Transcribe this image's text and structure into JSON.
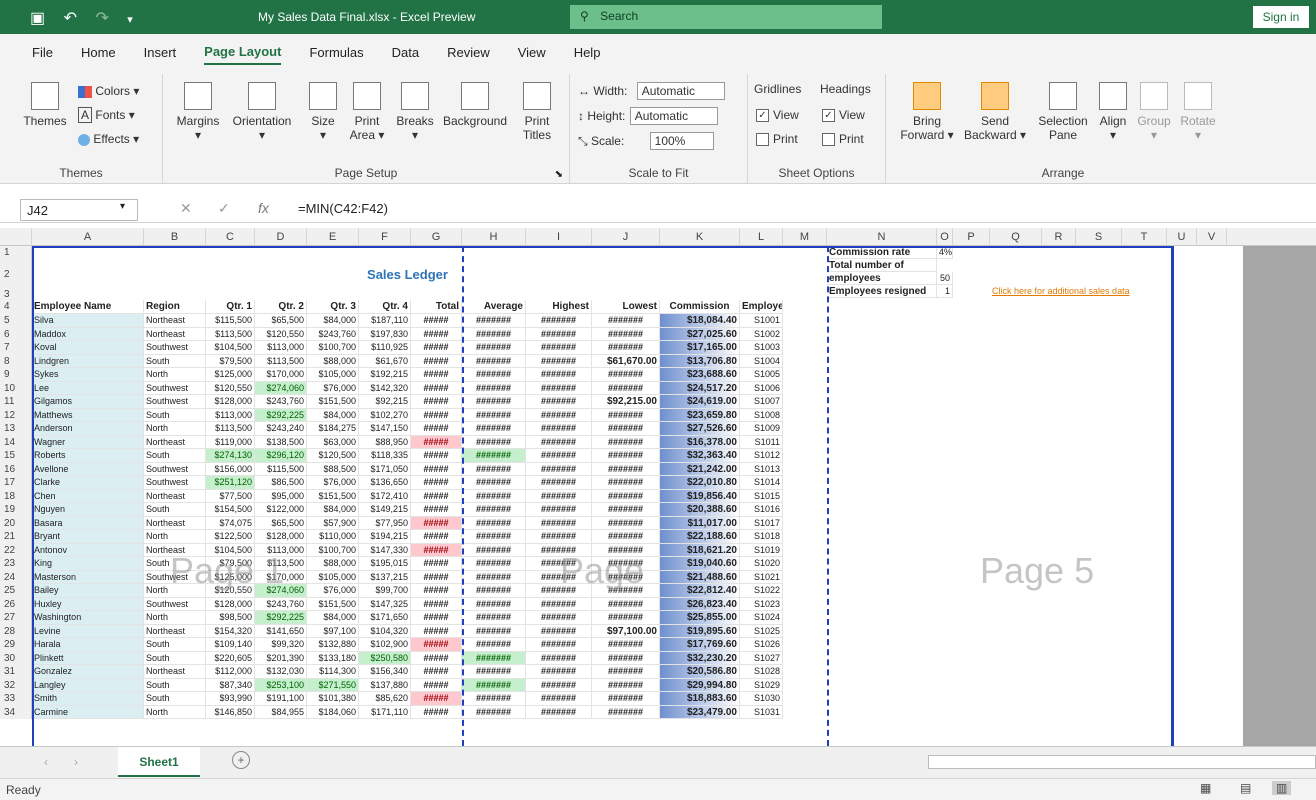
{
  "window": {
    "title": "My Sales Data Final.xlsx  -  Excel Preview",
    "search": "Search",
    "signin": "Sign in"
  },
  "tabs": [
    "File",
    "Home",
    "Insert",
    "Page Layout",
    "Formulas",
    "Data",
    "Review",
    "View",
    "Help"
  ],
  "ribbon": {
    "themes": {
      "label": "Themes",
      "colors": "Colors",
      "fonts": "Fonts",
      "effects": "Effects",
      "group": "Themes"
    },
    "page_setup": {
      "margins": "Margins",
      "orientation": "Orientation",
      "size": "Size",
      "print_area_1": "Print",
      "print_area_2": "Area",
      "breaks": "Breaks",
      "background": "Background",
      "print_titles_1": "Print",
      "print_titles_2": "Titles",
      "group": "Page Setup"
    },
    "scale_to_fit": {
      "width_label": "Width:",
      "width_value": "Automatic",
      "height_label": "Height:",
      "height_value": "Automatic",
      "scale_label": "Scale:",
      "scale_value": "100%",
      "group": "Scale to Fit"
    },
    "sheet_options": {
      "gridlines": "Gridlines",
      "headings": "Headings",
      "view": "View",
      "print": "Print",
      "group": "Sheet Options"
    },
    "arrange": {
      "bring_forward_1": "Bring",
      "bring_forward_2": "Forward",
      "send_backward_1": "Send",
      "send_backward_2": "Backward",
      "selection_pane_1": "Selection",
      "selection_pane_2": "Pane",
      "align": "Align",
      "group_btn": "Group",
      "rotate": "Rotate",
      "group": "Arrange"
    }
  },
  "formula_bar": {
    "name_box": "J42",
    "formula": "=MIN(C42:F42)",
    "fx": "fx"
  },
  "columns": [
    "A",
    "B",
    "C",
    "D",
    "E",
    "F",
    "G",
    "H",
    "I",
    "J",
    "K",
    "L",
    "M",
    "N",
    "O",
    "P",
    "Q",
    "R",
    "S",
    "T",
    "U",
    "V"
  ],
  "sheet": {
    "title": "Sales Ledger",
    "headers": [
      "Employee Name",
      "Region",
      "Qtr. 1",
      "Qtr. 2",
      "Qtr. 3",
      "Qtr. 4",
      "Total",
      "Average",
      "Highest",
      "Lowest",
      "Commission",
      "Employee ID"
    ],
    "side_info": {
      "commission_rate_label": "Commission rate",
      "commission_rate_value": "4%",
      "total_employees_label_1": "Total number of",
      "total_employees_label_2": "employees",
      "total_employees_value": "50",
      "resigned_label": "Employees resigned",
      "resigned_value": "1",
      "link": "Click here for additional sales data"
    },
    "rows": [
      {
        "n": "5",
        "name": "Silva",
        "region": "Northeast",
        "q1": "$115,500",
        "q2": "$65,500",
        "q3": "$84,000",
        "q4": "$187,110",
        "total": "#####",
        "avg": "#######",
        "high": "#######",
        "low": "#######",
        "comm": "$18,084.40",
        "id": "S1001"
      },
      {
        "n": "6",
        "name": "Maddox",
        "region": "Northeast",
        "q1": "$113,500",
        "q2": "$120,550",
        "q3": "$243,760",
        "q4": "$197,830",
        "total": "#####",
        "avg": "#######",
        "high": "#######",
        "low": "#######",
        "comm": "$27,025.60",
        "id": "S1002"
      },
      {
        "n": "7",
        "name": "Koval",
        "region": "Southwest",
        "q1": "$104,500",
        "q2": "$113,000",
        "q3": "$100,700",
        "q4": "$110,925",
        "total": "#####",
        "avg": "#######",
        "high": "#######",
        "low": "#######",
        "comm": "$17,165.00",
        "id": "S1003"
      },
      {
        "n": "8",
        "name": "Lindgren",
        "region": "South",
        "q1": "$79,500",
        "q2": "$113,500",
        "q3": "$88,000",
        "q4": "$61,670",
        "total": "#####",
        "avg": "#######",
        "high": "#######",
        "low": "$61,670.00",
        "comm": "$13,706.80",
        "id": "S1004"
      },
      {
        "n": "9",
        "name": "Sykes",
        "region": "North",
        "q1": "$125,000",
        "q2": "$170,000",
        "q3": "$105,000",
        "q4": "$192,215",
        "total": "#####",
        "avg": "#######",
        "high": "#######",
        "low": "#######",
        "comm": "$23,688.60",
        "id": "S1005"
      },
      {
        "n": "10",
        "name": "Lee",
        "region": "Southwest",
        "q1": "$120,550",
        "q2": "$274,060",
        "q3": "$76,000",
        "q4": "$142,320",
        "total": "#####",
        "avg": "#######",
        "high": "#######",
        "low": "#######",
        "comm": "$24,517.20",
        "id": "S1006"
      },
      {
        "n": "11",
        "name": "Gilgamos",
        "region": "Southwest",
        "q1": "$128,000",
        "q2": "$243,760",
        "q3": "$151,500",
        "q4": "$92,215",
        "total": "#####",
        "avg": "#######",
        "high": "#######",
        "low": "$92,215.00",
        "comm": "$24,619.00",
        "id": "S1007"
      },
      {
        "n": "12",
        "name": "Matthews",
        "region": "South",
        "q1": "$113,000",
        "q2": "$292,225",
        "q3": "$84,000",
        "q4": "$102,270",
        "total": "#####",
        "avg": "#######",
        "high": "#######",
        "low": "#######",
        "comm": "$23,659.80",
        "id": "S1008"
      },
      {
        "n": "13",
        "name": "Anderson",
        "region": "North",
        "q1": "$113,500",
        "q2": "$243,240",
        "q3": "$184,275",
        "q4": "$147,150",
        "total": "#####",
        "avg": "#######",
        "high": "#######",
        "low": "#######",
        "comm": "$27,526.60",
        "id": "S1009"
      },
      {
        "n": "14",
        "name": "Wagner",
        "region": "Northeast",
        "q1": "$119,000",
        "q2": "$138,500",
        "q3": "$63,000",
        "q4": "$88,950",
        "total": "#####",
        "avg": "#######",
        "high": "#######",
        "low": "#######",
        "comm": "$16,378.00",
        "id": "S1011"
      },
      {
        "n": "15",
        "name": "Roberts",
        "region": "South",
        "q1": "$274,130",
        "q2": "$296,120",
        "q3": "$120,500",
        "q4": "$118,335",
        "total": "#####",
        "avg": "#######",
        "high": "#######",
        "low": "#######",
        "comm": "$32,363.40",
        "id": "S1012"
      },
      {
        "n": "16",
        "name": "Avellone",
        "region": "Southwest",
        "q1": "$156,000",
        "q2": "$115,500",
        "q3": "$88,500",
        "q4": "$171,050",
        "total": "#####",
        "avg": "#######",
        "high": "#######",
        "low": "#######",
        "comm": "$21,242.00",
        "id": "S1013"
      },
      {
        "n": "17",
        "name": "Clarke",
        "region": "Southwest",
        "q1": "$251,120",
        "q2": "$86,500",
        "q3": "$76,000",
        "q4": "$136,650",
        "total": "#####",
        "avg": "#######",
        "high": "#######",
        "low": "#######",
        "comm": "$22,010.80",
        "id": "S1014"
      },
      {
        "n": "18",
        "name": "Chen",
        "region": "Northeast",
        "q1": "$77,500",
        "q2": "$95,000",
        "q3": "$151,500",
        "q4": "$172,410",
        "total": "#####",
        "avg": "#######",
        "high": "#######",
        "low": "#######",
        "comm": "$19,856.40",
        "id": "S1015"
      },
      {
        "n": "19",
        "name": "Nguyen",
        "region": "South",
        "q1": "$154,500",
        "q2": "$122,000",
        "q3": "$84,000",
        "q4": "$149,215",
        "total": "#####",
        "avg": "#######",
        "high": "#######",
        "low": "#######",
        "comm": "$20,388.60",
        "id": "S1016"
      },
      {
        "n": "20",
        "name": "Basara",
        "region": "Northeast",
        "q1": "$74,075",
        "q2": "$65,500",
        "q3": "$57,900",
        "q4": "$77,950",
        "total": "#####",
        "avg": "#######",
        "high": "#######",
        "low": "#######",
        "comm": "$11,017.00",
        "id": "S1017"
      },
      {
        "n": "21",
        "name": "Bryant",
        "region": "North",
        "q1": "$122,500",
        "q2": "$128,000",
        "q3": "$110,000",
        "q4": "$194,215",
        "total": "#####",
        "avg": "#######",
        "high": "#######",
        "low": "#######",
        "comm": "$22,188.60",
        "id": "S1018"
      },
      {
        "n": "22",
        "name": "Antonov",
        "region": "Northeast",
        "q1": "$104,500",
        "q2": "$113,000",
        "q3": "$100,700",
        "q4": "$147,330",
        "total": "#####",
        "avg": "#######",
        "high": "#######",
        "low": "#######",
        "comm": "$18,621.20",
        "id": "S1019"
      },
      {
        "n": "23",
        "name": "King",
        "region": "South",
        "q1": "$79,500",
        "q2": "$113,500",
        "q3": "$88,000",
        "q4": "$195,015",
        "total": "#####",
        "avg": "#######",
        "high": "#######",
        "low": "#######",
        "comm": "$19,040.60",
        "id": "S1020"
      },
      {
        "n": "24",
        "name": "Masterson",
        "region": "Southwest",
        "q1": "$125,000",
        "q2": "$170,000",
        "q3": "$105,000",
        "q4": "$137,215",
        "total": "#####",
        "avg": "#######",
        "high": "#######",
        "low": "#######",
        "comm": "$21,488.60",
        "id": "S1021"
      },
      {
        "n": "25",
        "name": "Bailey",
        "region": "North",
        "q1": "$120,550",
        "q2": "$274,060",
        "q3": "$76,000",
        "q4": "$99,700",
        "total": "#####",
        "avg": "#######",
        "high": "#######",
        "low": "#######",
        "comm": "$22,812.40",
        "id": "S1022"
      },
      {
        "n": "26",
        "name": "Huxley",
        "region": "Southwest",
        "q1": "$128,000",
        "q2": "$243,760",
        "q3": "$151,500",
        "q4": "$147,325",
        "total": "#####",
        "avg": "#######",
        "high": "#######",
        "low": "#######",
        "comm": "$26,823.40",
        "id": "S1023"
      },
      {
        "n": "27",
        "name": "Washington",
        "region": "North",
        "q1": "$98,500",
        "q2": "$292,225",
        "q3": "$84,000",
        "q4": "$171,650",
        "total": "#####",
        "avg": "#######",
        "high": "#######",
        "low": "#######",
        "comm": "$25,855.00",
        "id": "S1024"
      },
      {
        "n": "28",
        "name": "Levine",
        "region": "Northeast",
        "q1": "$154,320",
        "q2": "$141,650",
        "q3": "$97,100",
        "q4": "$104,320",
        "total": "#####",
        "avg": "#######",
        "high": "#######",
        "low": "$97,100.00",
        "comm": "$19,895.60",
        "id": "S1025"
      },
      {
        "n": "29",
        "name": "Harala",
        "region": "South",
        "q1": "$109,140",
        "q2": "$99,320",
        "q3": "$132,880",
        "q4": "$102,900",
        "total": "#####",
        "avg": "#######",
        "high": "#######",
        "low": "#######",
        "comm": "$17,769.60",
        "id": "S1026"
      },
      {
        "n": "30",
        "name": "Plinkett",
        "region": "South",
        "q1": "$220,605",
        "q2": "$201,390",
        "q3": "$133,180",
        "q4": "$250,580",
        "total": "#####",
        "avg": "#######",
        "high": "#######",
        "low": "#######",
        "comm": "$32,230.20",
        "id": "S1027"
      },
      {
        "n": "31",
        "name": "Gonzalez",
        "region": "Northeast",
        "q1": "$112,000",
        "q2": "$132,030",
        "q3": "$114,300",
        "q4": "$156,340",
        "total": "#####",
        "avg": "#######",
        "high": "#######",
        "low": "#######",
        "comm": "$20,586.80",
        "id": "S1028"
      },
      {
        "n": "32",
        "name": "Langley",
        "region": "South",
        "q1": "$87,340",
        "q2": "$253,100",
        "q3": "$271,550",
        "q4": "$137,880",
        "total": "#####",
        "avg": "#######",
        "high": "#######",
        "low": "#######",
        "comm": "$29,994.80",
        "id": "S1029"
      },
      {
        "n": "33",
        "name": "Smith",
        "region": "South",
        "q1": "$93,990",
        "q2": "$191,100",
        "q3": "$101,380",
        "q4": "$85,620",
        "total": "#####",
        "avg": "#######",
        "high": "#######",
        "low": "#######",
        "comm": "$18,883.60",
        "id": "S1030"
      },
      {
        "n": "34",
        "name": "Carmine",
        "region": "North",
        "q1": "$146,850",
        "q2": "$84,955",
        "q3": "$184,060",
        "q4": "$171,110",
        "total": "#####",
        "avg": "#######",
        "high": "#######",
        "low": "#######",
        "comm": "$23,479.00",
        "id": "S1031"
      }
    ],
    "watermarks": [
      "Page 1",
      "Page",
      "Page 5"
    ]
  },
  "sheet_tab": "Sheet1",
  "status": "Ready",
  "colors": {
    "accent": "#217346",
    "page_break": "#1f3fbf",
    "link": "#e07b00"
  }
}
